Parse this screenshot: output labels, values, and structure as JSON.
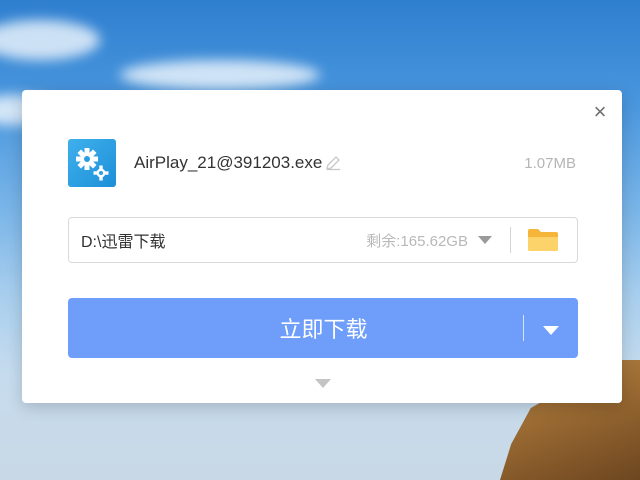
{
  "dialog": {
    "close_icon": "close-icon",
    "file": {
      "icon": "settings-gears-icon",
      "name": "AirPlay_21@391203.exe",
      "rename_icon": "edit-pencil-icon",
      "size": "1.07MB"
    },
    "path": {
      "value": "D:\\迅雷下载",
      "free_space": "剩余:165.62GB",
      "dropdown_icon": "chevron-down-icon",
      "folder_icon": "folder-icon"
    },
    "download_button": {
      "label": "立即下载",
      "menu_icon": "caret-down-icon"
    },
    "expand_icon": "expand-down-icon"
  },
  "colors": {
    "primary_button": "#6e9dfa",
    "file_icon": "#2a9ee3",
    "folder": "#f7c04d",
    "muted_text": "#b5b5b5"
  }
}
